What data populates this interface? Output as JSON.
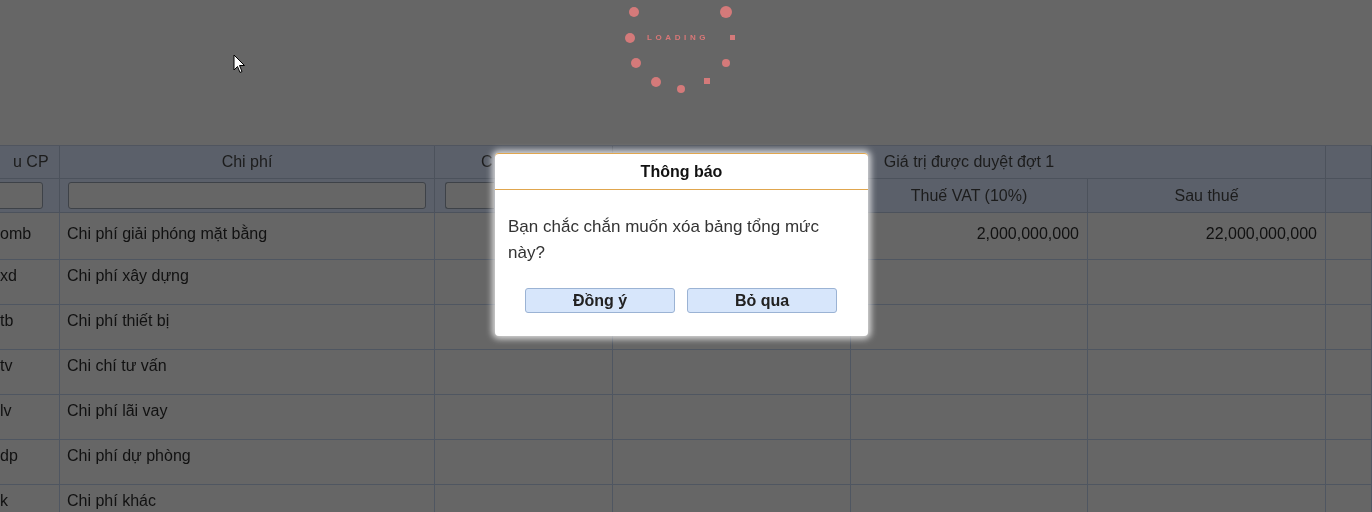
{
  "loading": {
    "text": "LOADING"
  },
  "table": {
    "header": [
      {
        "label": "u CP",
        "filter": true
      },
      {
        "label": "Chi phí",
        "filter": true
      },
      {
        "label": "C",
        "filter": true
      }
    ],
    "group": {
      "label": "Giá trị được duyệt đợt 1",
      "sub": [
        "Thuế VAT (10%)",
        "Sau thuế"
      ]
    },
    "rows": [
      {
        "code": "omb",
        "name": "Chi phí giải phóng mặt bằng",
        "vat": "2,000,000,000",
        "after_tax": "22,000,000,000"
      },
      {
        "code": "xd",
        "name": "Chi phí xây dựng"
      },
      {
        "code": "tb",
        "name": "Chi phí thiết bị"
      },
      {
        "code": "tv",
        "name": "Chi chí tư vấn"
      },
      {
        "code": "lv",
        "name": "Chi phí lãi vay"
      },
      {
        "code": "dp",
        "name": "Chi phí dự phòng"
      },
      {
        "code": "k",
        "name": "Chi phí khác"
      }
    ]
  },
  "dialog": {
    "title": "Thông báo",
    "message": "Bạn chắc chắn muốn xóa bảng tổng mức này?",
    "buttons": [
      "Đồng ý",
      "Bỏ qua"
    ]
  }
}
